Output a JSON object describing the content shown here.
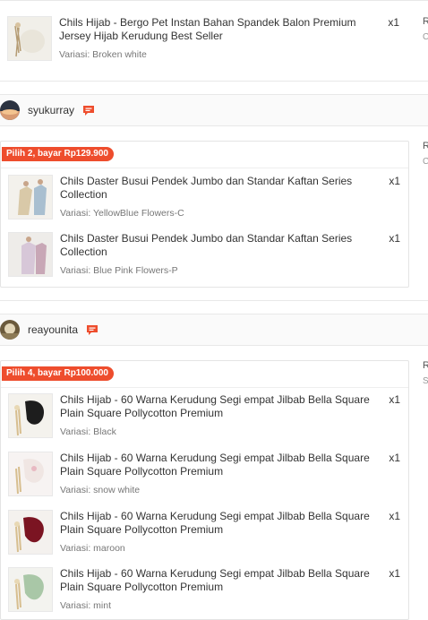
{
  "orders": [
    {
      "items": [
        {
          "title": "Chils Hijab - Bergo Pet Instan Bahan Spandek Balon Premium Jersey Hijab Kerudung Best Seller",
          "variant": "Variasi: Broken white",
          "qty": "x1"
        }
      ],
      "side_label": "R",
      "side_sub": "C"
    },
    {
      "shop": "syukurray",
      "promo": "Pilih 2, bayar Rp129.900",
      "items": [
        {
          "title": "Chils Daster Busui Pendek Jumbo dan Standar Kaftan Series Collection",
          "variant": "Variasi: YellowBlue Flowers-C",
          "qty": "x1"
        },
        {
          "title": "Chils Daster Busui Pendek Jumbo dan Standar Kaftan Series Collection",
          "variant": "Variasi: Blue Pink Flowers-P",
          "qty": "x1"
        }
      ],
      "side_label": "R",
      "side_sub": "C"
    },
    {
      "shop": "reayounita",
      "promo": "Pilih 4, bayar Rp100.000",
      "items": [
        {
          "title": "Chils Hijab - 60 Warna Kerudung Segi empat Jilbab Bella Square Plain Square Pollycotton Premium",
          "variant": "Variasi: Black",
          "qty": "x1"
        },
        {
          "title": "Chils Hijab - 60 Warna Kerudung Segi empat Jilbab Bella Square Plain Square Pollycotton Premium",
          "variant": "Variasi: snow white",
          "qty": "x1"
        },
        {
          "title": "Chils Hijab - 60 Warna Kerudung Segi empat Jilbab Bella Square Plain Square Pollycotton Premium",
          "variant": "Variasi: maroon",
          "qty": "x1"
        },
        {
          "title": "Chils Hijab - 60 Warna Kerudung Segi empat Jilbab Bella Square Plain Square Pollycotton Premium",
          "variant": "Variasi: mint",
          "qty": "x1"
        }
      ],
      "side_label": "R",
      "side_sub": "S"
    }
  ],
  "icons": {
    "chat": "chat-icon"
  },
  "colors": {
    "accent": "#ee4d2d"
  }
}
